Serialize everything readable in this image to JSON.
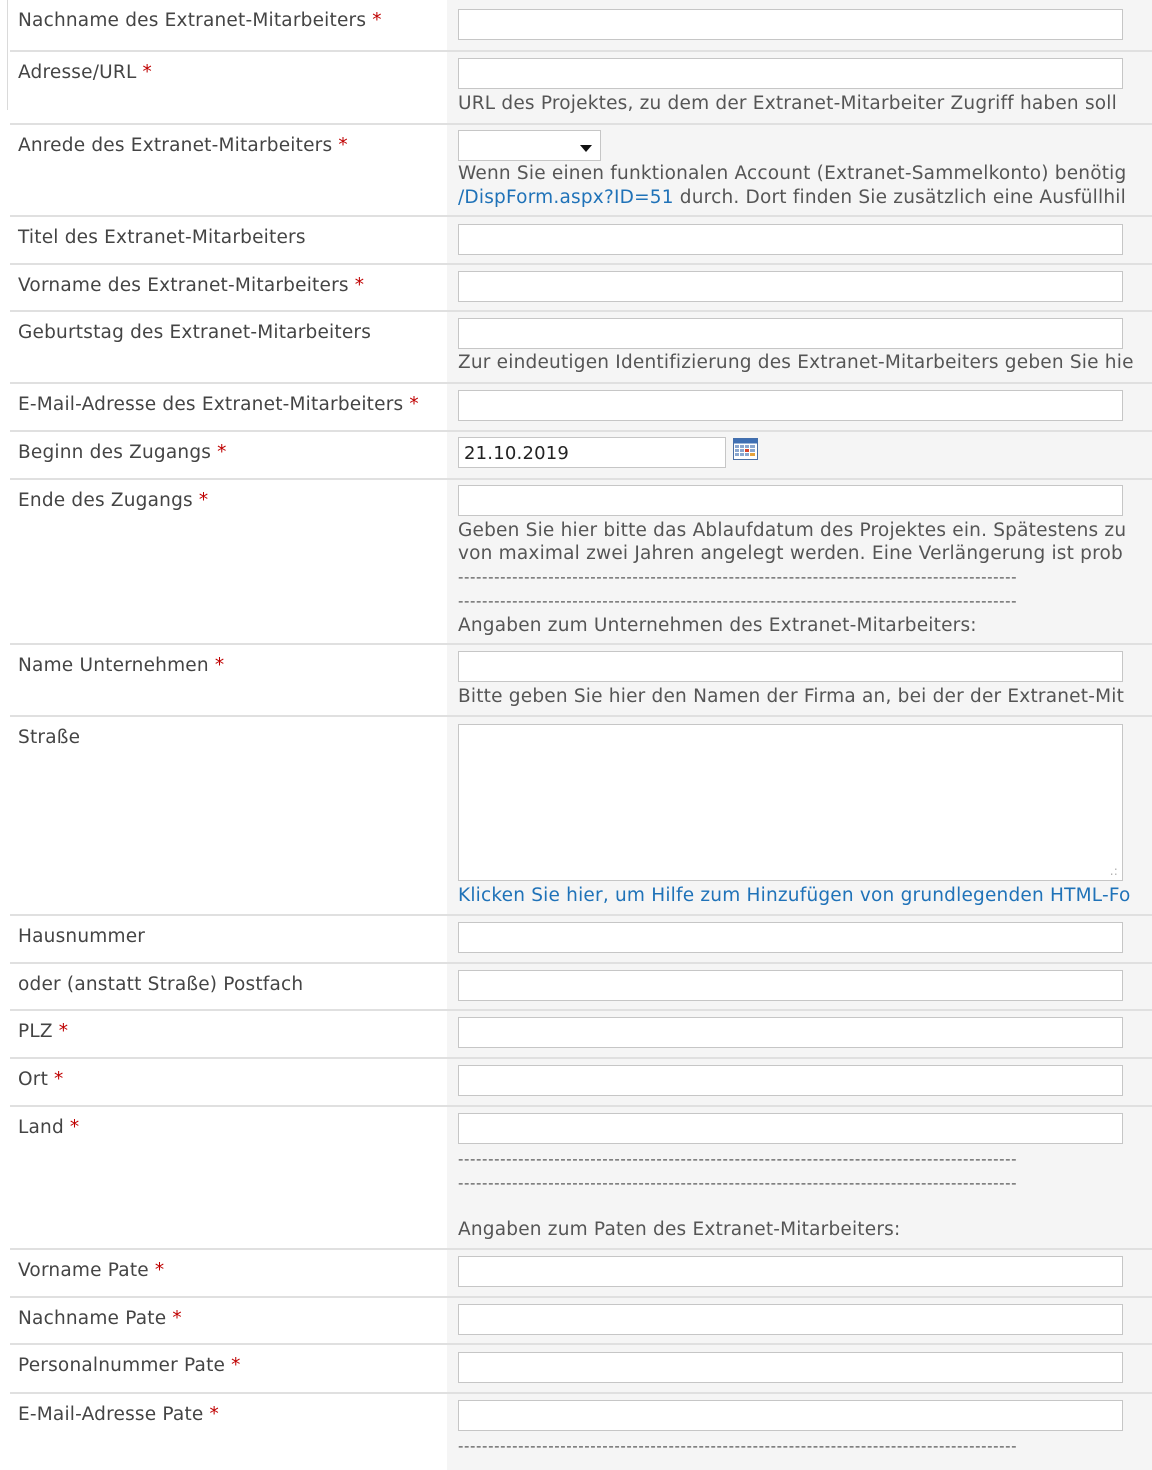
{
  "required_marker": "*",
  "fields": {
    "nachname": {
      "label": "Nachname des Extranet-Mitarbeiters"
    },
    "adresse": {
      "label": "Adresse/URL",
      "hint": "URL des Projektes, zu dem der Extranet-Mitarbeiter Zugriff haben soll"
    },
    "anrede": {
      "label": "Anrede des Extranet-Mitarbeiters",
      "selected": "",
      "hint_line1": "Wenn Sie einen funktionalen Account (Extranet-Sammelkonto) benötig",
      "hint_link": "/DispForm.aspx?ID=51",
      "hint_line2": " durch. Dort finden Sie zusätzlich eine Ausfüllhil"
    },
    "titel": {
      "label": "Titel des Extranet-Mitarbeiters"
    },
    "vorname": {
      "label": "Vorname des Extranet-Mitarbeiters"
    },
    "geburtstag": {
      "label": "Geburtstag des Extranet-Mitarbeiters",
      "hint": "Zur eindeutigen Identifizierung des Extranet-Mitarbeiters geben Sie hie"
    },
    "email": {
      "label": "E-Mail-Adresse des Extranet-Mitarbeiters"
    },
    "beginn": {
      "label": "Beginn des Zugangs",
      "value": "21.10.2019",
      "icon": "calendar-icon"
    },
    "ende": {
      "label": "Ende des Zugangs",
      "hint_line1": "Geben Sie hier bitte das Ablaufdatum des Projektes ein. Spätestens zu",
      "hint_line2": "von maximal zwei Jahren angelegt werden. Eine Verlängerung ist prob",
      "separator": "---------------------------------------------------------------------------------------------",
      "section_title": "Angaben zum Unternehmen des Extranet-Mitarbeiters:"
    },
    "unternehmen": {
      "label": "Name Unternehmen",
      "hint": "Bitte geben Sie hier den Namen der Firma an, bei der der Extranet-Mit"
    },
    "strasse": {
      "label": "Straße",
      "help_link": "Klicken Sie hier, um Hilfe zum Hinzufügen von grundlegenden HTML-Fo"
    },
    "hausnummer": {
      "label": "Hausnummer"
    },
    "postfach": {
      "label": "oder (anstatt Straße) Postfach"
    },
    "plz": {
      "label": "PLZ"
    },
    "ort": {
      "label": "Ort"
    },
    "land": {
      "label": "Land",
      "separator": "---------------------------------------------------------------------------------------------",
      "section_title": "Angaben zum Paten des Extranet-Mitarbeiters:"
    },
    "vorname_pate": {
      "label": "Vorname Pate"
    },
    "nachname_pate": {
      "label": "Nachname Pate"
    },
    "personalnummer_pate": {
      "label": "Personalnummer Pate"
    },
    "email_pate": {
      "label": "E-Mail-Adresse Pate",
      "separator": "---------------------------------------------------------------------------------------------"
    }
  },
  "colors": {
    "required": "#bf0000",
    "link": "#1f72b8",
    "value_column_bg": "#f5f5f5",
    "row_border": "#e0e0e0"
  }
}
